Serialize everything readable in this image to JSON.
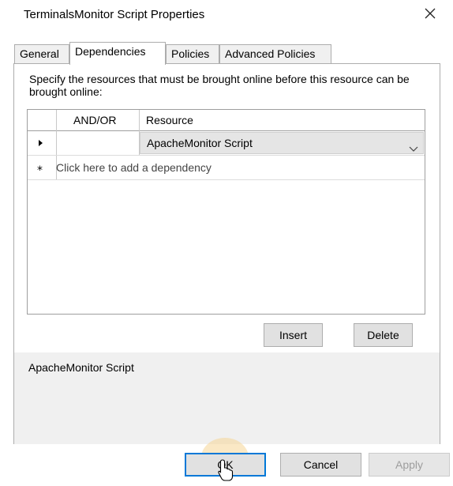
{
  "window": {
    "title": "TerminalsMonitor Script Properties"
  },
  "tabs": [
    {
      "label": "General"
    },
    {
      "label": "Dependencies"
    },
    {
      "label": "Policies"
    },
    {
      "label": "Advanced Policies"
    }
  ],
  "active_tab": "Dependencies",
  "dependencies": {
    "description": "Specify the resources that must be brought online before this resource can be brought online:",
    "columns": {
      "andor": "AND/OR",
      "resource": "Resource"
    },
    "rows": [
      {
        "andor": "",
        "resource": "ApacheMonitor Script",
        "indicator": "current-row-arrow-icon"
      }
    ],
    "new_row_placeholder": "Click here to add a dependency",
    "insert_label": "Insert",
    "delete_label": "Delete",
    "expression": "ApacheMonitor Script"
  },
  "footer": {
    "ok_label": "OK",
    "cancel_label": "Cancel",
    "apply_label": "Apply"
  },
  "colors": {
    "accent": "#0078d7",
    "tab_bg": "#f0f0f0",
    "combo_bg": "#e5e5e5"
  }
}
